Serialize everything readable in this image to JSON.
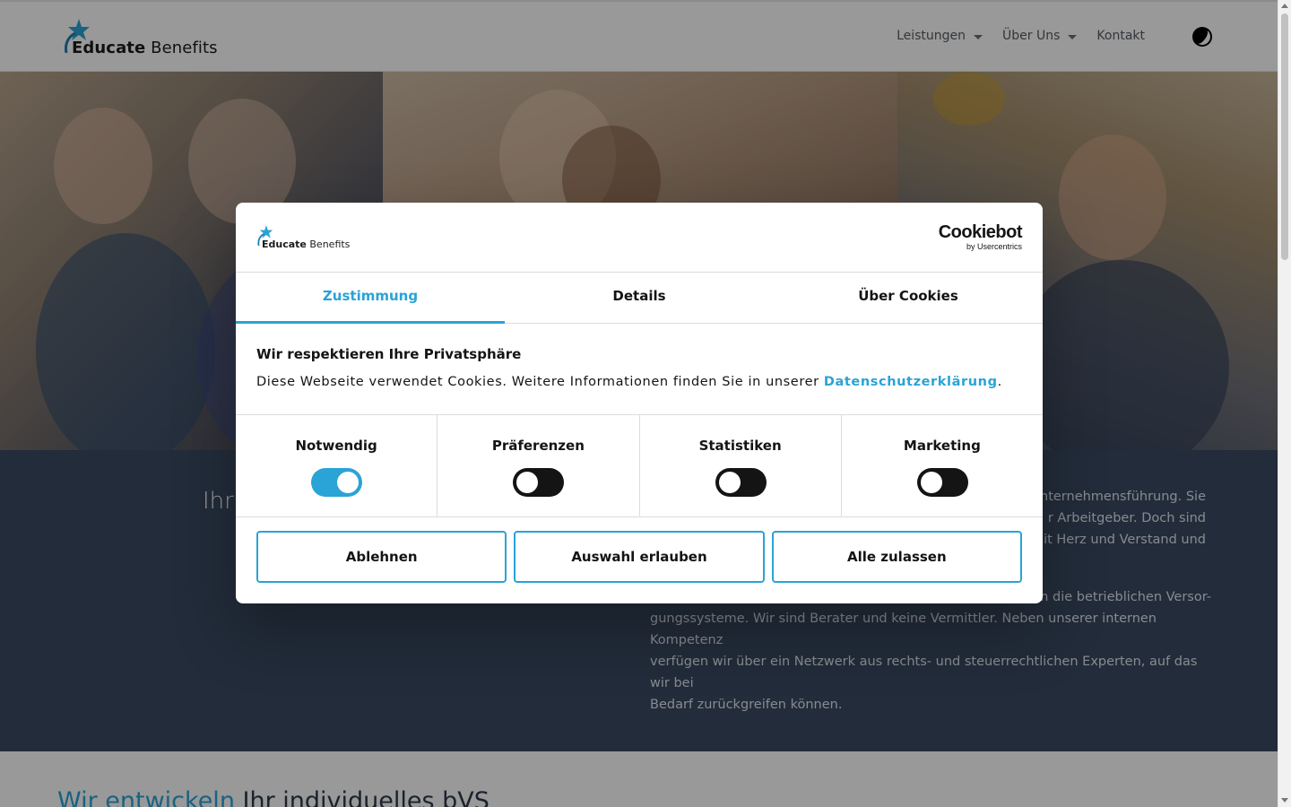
{
  "brand": {
    "name_bold": "Educate",
    "name_light": " Benefits"
  },
  "nav": {
    "items": [
      {
        "label": "Leistungen",
        "has_dropdown": true
      },
      {
        "label": "Über Uns",
        "has_dropdown": true
      },
      {
        "label": "Kontakt",
        "has_dropdown": false
      }
    ],
    "contrast_icon": "contrast-icon"
  },
  "dark_section": {
    "heading": "Ihr",
    "paragraph1": "nternehmensführung. Sie … r Arbeitgeber. Doch sind … mit Herz und Verstand und",
    "paragraph1_lines": [
      "nternehmensführung. Sie",
      "r Arbeitgeber. Doch sind",
      "mit Herz und Verstand und"
    ],
    "paragraph2_lines": [
      "m die betrieblichen Versor-",
      "gungssysteme. Wir sind Berater und keine Vermittler. Neben unserer internen Kompetenz",
      "verfügen wir über ein Netzwerk aus rechts- und steuerrechtlichen Experten, auf das wir bei",
      "Bedarf zurückgreifen können."
    ]
  },
  "white_section": {
    "heading_accent": "Wir entwickeln",
    "heading_rest": " Ihr individuelles bVS"
  },
  "cookie_dialog": {
    "provider": {
      "name": "Cookiebot",
      "sub": "by Usercentrics"
    },
    "tabs": [
      {
        "label": "Zustimmung",
        "active": true
      },
      {
        "label": "Details",
        "active": false
      },
      {
        "label": "Über Cookies",
        "active": false
      }
    ],
    "title": "Wir respektieren Ihre Privatsphäre",
    "text": "Diese Webseite verwendet Cookies. Weitere Informationen finden Sie in unserer ",
    "link": "Datenschutzerklärung",
    "text_end": ".",
    "categories": [
      {
        "label": "Notwendig",
        "enabled": true
      },
      {
        "label": "Präferenzen",
        "enabled": false
      },
      {
        "label": "Statistiken",
        "enabled": false
      },
      {
        "label": "Marketing",
        "enabled": false
      }
    ],
    "buttons": {
      "deny": "Ablehnen",
      "allow_selection": "Auswahl erlauben",
      "allow_all": "Alle zulassen"
    }
  },
  "colors": {
    "accent": "#2aa3d6",
    "dark_section": "#394a62",
    "text": "#141414"
  }
}
